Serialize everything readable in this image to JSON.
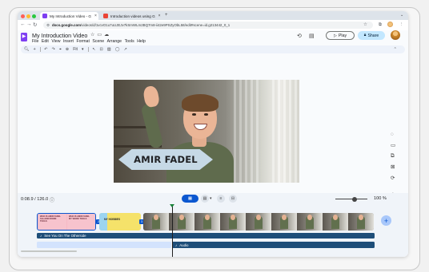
{
  "browser": {
    "tabs": [
      {
        "label": "My Introduction Video - G",
        "active": true,
        "favicon_color": "#7e3ff2"
      },
      {
        "label": "Introduction videos using G",
        "active": false,
        "favicon_color": "#ea4335"
      }
    ],
    "tab_close": "×",
    "new_tab": "+",
    "url_domain": "docs.google.com",
    "url_path": "/videos/d/1vcvO1u7uUJEJv7kSmWLm2BQ7m8-ii42e9PSZyObL58/edit#scene=id.g213442_0_1"
  },
  "app": {
    "logo_letter": "▶",
    "title": "My Introduction Video",
    "menu": [
      "File",
      "Edit",
      "View",
      "Insert",
      "Format",
      "Scene",
      "Arrange",
      "Tools",
      "Help"
    ],
    "play_label": "Play",
    "share_label": "Share"
  },
  "toolbar": {
    "zoom_label": "Fit"
  },
  "canvas": {
    "name_text": "AMIR FADEL"
  },
  "timeline": {
    "time_readout": "0:08.9 / 126.0",
    "zoom_value": "100 %",
    "scene_a_left": "WHO IS AMIR FADEL SALADIN WORK TOOLS",
    "scene_a_right": "WHO IS AMIR FADEL MY WORK TOOLS",
    "scene_b_label": "MY HOBBIES",
    "scene_tag_1": "2",
    "scene_tag_2": "3",
    "audio_track_1": "See You On The Otherside",
    "audio_track_2": "Audio"
  },
  "colors": {
    "accent": "#0b57d0",
    "share_bg": "#c2e7ff",
    "brand": "#7e3ff2",
    "audio_track": "#1e4e79"
  }
}
